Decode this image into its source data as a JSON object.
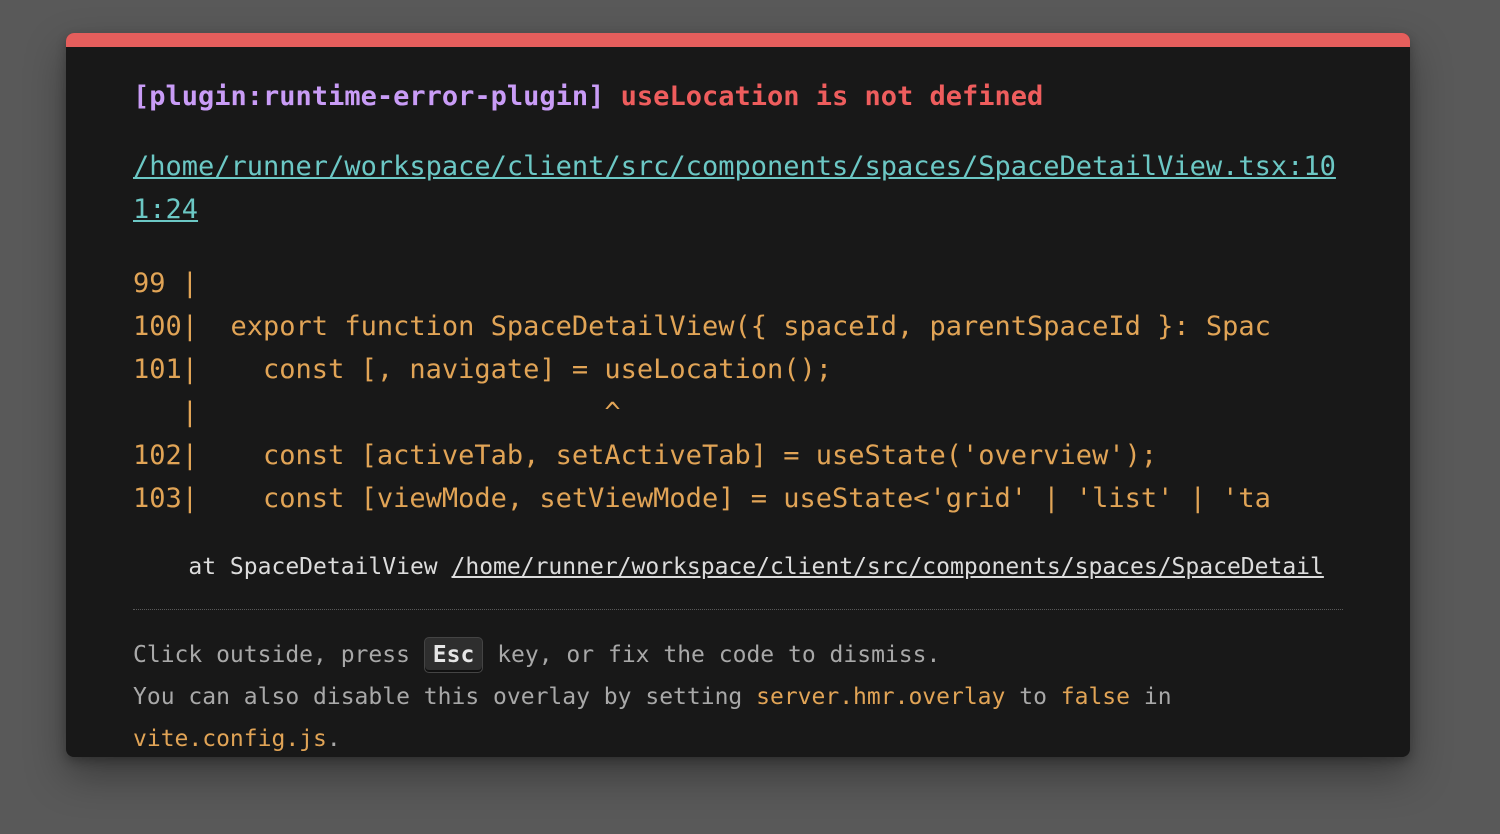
{
  "error": {
    "plugin": "[plugin:runtime-error-plugin]",
    "message": "useLocation is not defined",
    "file": "/home/runner/workspace/client/src/components/spaces/SpaceDetailView.tsx:101:24"
  },
  "frame_lines": [
    "99 |",
    "100|  export function SpaceDetailView({ spaceId, parentSpaceId }: Spac",
    "101|    const [, navigate] = useLocation();",
    "   |                         ^",
    "102|    const [activeTab, setActiveTab] = useState('overview');",
    "103|    const [viewMode, setViewMode] = useState<'grid' | 'list' | 'ta"
  ],
  "stack": {
    "prefix": "    at SpaceDetailView ",
    "link": "/home/runner/workspace/client/src/components/spaces/SpaceDetail"
  },
  "tip": {
    "line1_before": "Click outside, press ",
    "key": "Esc",
    "line1_after": " key, or fix the code to dismiss.",
    "line2_before": "You can also disable this overlay by setting ",
    "setting": "server.hmr.overlay",
    "line2_mid": " to ",
    "value": "false",
    "line2_after": " in",
    "config_file": "vite.config.js",
    "period": "."
  },
  "colors": {
    "accent_bar": "#e45e5c",
    "plugin": "#c99cf6",
    "message": "#ee5d5d",
    "file_link": "#6cc8c5",
    "code": "#e1a456"
  }
}
